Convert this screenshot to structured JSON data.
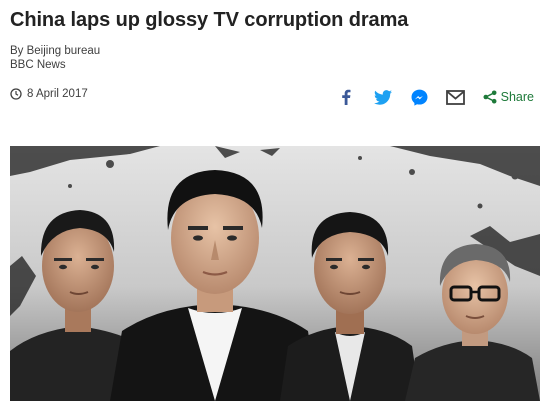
{
  "article": {
    "headline": "China laps up glossy TV corruption drama",
    "byline": "By Beijing bureau",
    "source": "BBC News",
    "date": "8 April 2017"
  },
  "share": {
    "label": "Share",
    "icons": [
      "facebook-icon",
      "twitter-icon",
      "messenger-icon",
      "email-icon",
      "share-icon"
    ]
  },
  "image": {
    "subject": "poster-four-men"
  },
  "colors": {
    "headline": "#222222",
    "meta": "#404040",
    "facebook": "#3b5998",
    "twitter": "#1da1f2",
    "messenger": "#0084ff",
    "email": "#404040",
    "share": "#1e7a3a"
  }
}
